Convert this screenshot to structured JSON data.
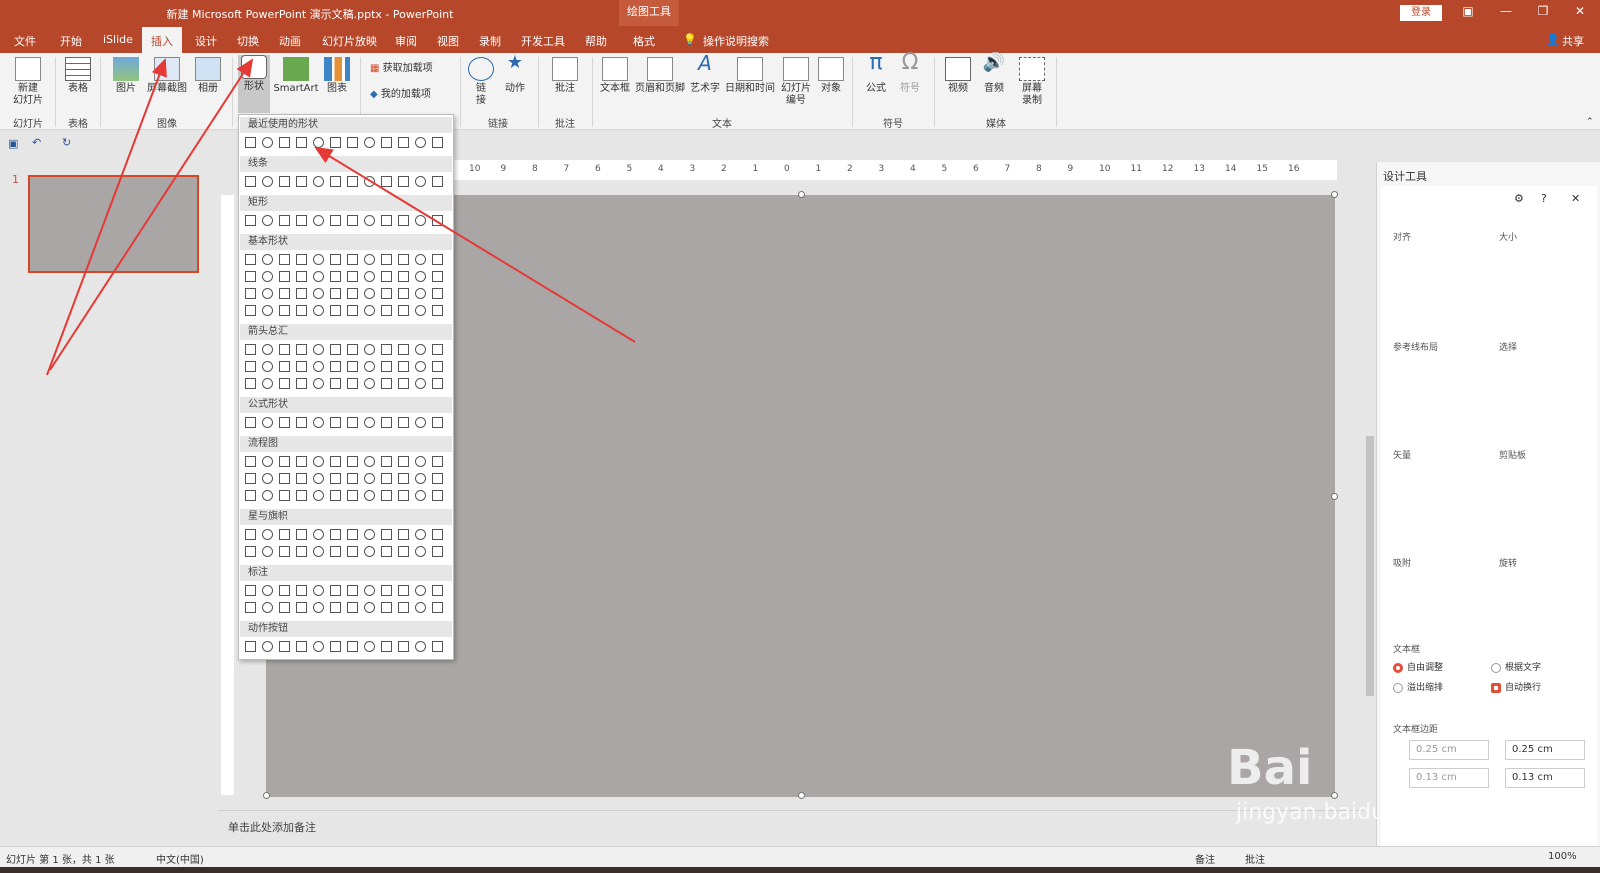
{
  "app": {
    "window_title": "新建 Microsoft PowerPoint 演示文稿.pptx - PowerPoint",
    "context_tab_group": "绘图工具",
    "login_label": "登录",
    "share_label": "共享",
    "tell_me": "操作说明搜索"
  },
  "menu": {
    "file": "文件",
    "home": "开始",
    "islide": "iSlide",
    "insert": "插入",
    "design": "设计",
    "transitions": "切换",
    "animations": "动画",
    "slideshow": "幻灯片放映",
    "review": "审阅",
    "view": "视图",
    "record": "录制",
    "developer": "开发工具",
    "help": "帮助",
    "format": "格式"
  },
  "ribbon": {
    "new_slide": "新建\n幻灯片",
    "table": "表格",
    "pictures": "图片",
    "screenshot": "屏幕截图",
    "album": "相册",
    "shapes": "形状",
    "smartart": "SmartArt",
    "chart": "图表",
    "get_addins": "获取加载项",
    "my_addins": "我的加载项",
    "link": "链\n接",
    "action": "动作",
    "comment": "批注",
    "textbox": "文本框",
    "header_footer": "页眉和页脚",
    "wordart": "艺术字",
    "datetime": "日期和时间",
    "slide_number": "幻灯片\n编号",
    "object": "对象",
    "equation": "公式",
    "symbol": "符号",
    "video": "视频",
    "audio": "音频",
    "screen_record": "屏幕\n录制",
    "groups": {
      "slides": "幻灯片",
      "tables": "表格",
      "images": "图像",
      "links": "链接",
      "comments": "批注",
      "text": "文本",
      "symbols": "符号",
      "media": "媒体"
    }
  },
  "shapes_menu": {
    "categories": [
      "最近使用的形状",
      "线条",
      "矩形",
      "基本形状",
      "箭头总汇",
      "公式形状",
      "流程图",
      "星与旗帜",
      "标注",
      "动作按钮"
    ]
  },
  "slide_panel": {
    "slide_number": "1"
  },
  "ruler": {
    "ticks": [
      "10",
      "9",
      "8",
      "7",
      "6",
      "5",
      "4",
      "3",
      "2",
      "1",
      "0",
      "1",
      "2",
      "3",
      "4",
      "5",
      "6",
      "7",
      "8",
      "9",
      "10",
      "11",
      "12",
      "13",
      "14",
      "15",
      "16"
    ]
  },
  "notes": {
    "placeholder": "单击此处添加备注"
  },
  "design_panel": {
    "title": "设计工具",
    "align": "对齐",
    "size": "大小",
    "guides": "参考线布局",
    "select": "选择",
    "vector": "矢量",
    "clipboard": "剪贴板",
    "snap": "吸附",
    "rotate": "旋转",
    "textbox": "文本框",
    "auto_fit": "自由调整",
    "by_text": "根据文字",
    "overflow": "溢出缩排",
    "auto_wrap": "自动换行",
    "margin": "文本框边距",
    "margin_left": "0.25 cm",
    "margin_right": "0.25 cm",
    "margin_top": "0.13 cm",
    "margin_bottom": "0.13 cm"
  },
  "status": {
    "slide_info": "幻灯片 第 1 张，共 1 张",
    "language": "中文(中国)",
    "notes_btn": "备注",
    "comments_btn": "批注",
    "zoom": "100%"
  },
  "colors": {
    "accent": "#b7472a",
    "slide_bg": "#aaa6a6",
    "arrow": "#e53935"
  }
}
